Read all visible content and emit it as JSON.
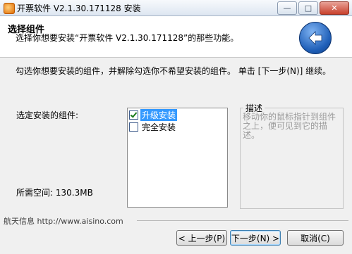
{
  "window": {
    "title": "开票软件 V2.1.30.171128 安装",
    "minimize_symbol": "—",
    "maximize_symbol": "□",
    "close_symbol": "✕"
  },
  "header": {
    "title": "选择组件",
    "description": "选择你想要安装“开票软件 V2.1.30.171128”的那些功能。"
  },
  "instruction": "勾选你想要安装的组件，并解除勾选你不希望安装的组件。 单击 [下一步(N)] 继续。",
  "components": {
    "label": "选定安装的组件:",
    "items": [
      {
        "label": "升级安装",
        "checked": true,
        "selected": true
      },
      {
        "label": "完全安装",
        "checked": false,
        "selected": false
      }
    ]
  },
  "description_box": {
    "title": "描述",
    "text": "移动你的鼠标指针到组件之上，便可见到它的描述。"
  },
  "space_required": "所需空间: 130.3MB",
  "footer": {
    "brand_link": "航天信息 http://www.aisino.com"
  },
  "buttons": {
    "back": "< 上一步(P)",
    "next": "下一步(N) >",
    "cancel": "取消(C)"
  },
  "colors": {
    "selection": "#3399ff",
    "back_icon": "#1f5fb8",
    "description_text": "#9a9a9a"
  },
  "icons": {
    "app": "invoice-app-icon",
    "back": "back-arrow-icon"
  }
}
